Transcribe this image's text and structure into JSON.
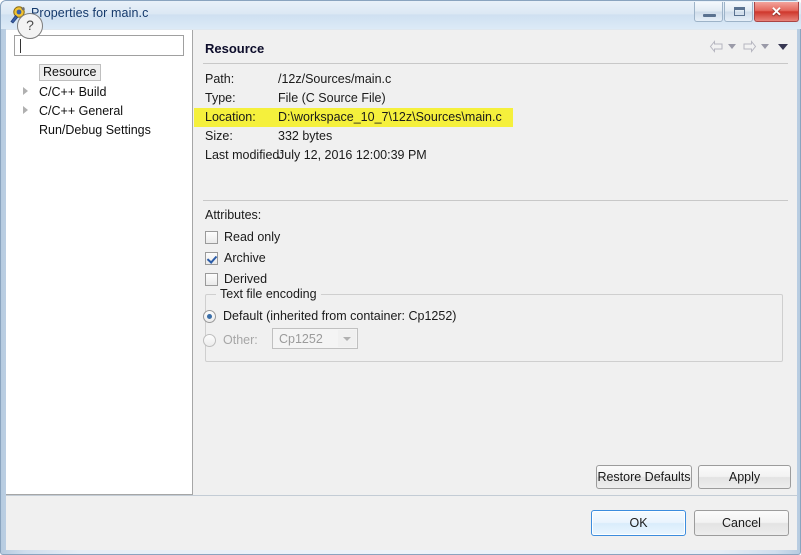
{
  "window": {
    "title": "Properties for main.c",
    "icon": "eclipse-properties-icon",
    "minimize_label": "Minimize",
    "maximize_label": "Maximize",
    "close_label": "Close",
    "close_glyph": "✕"
  },
  "sidebar": {
    "filter": {
      "value": "",
      "placeholder": ""
    },
    "items": [
      {
        "label": "Resource",
        "selected": true,
        "expandable": false
      },
      {
        "label": "C/C++ Build",
        "selected": false,
        "expandable": true
      },
      {
        "label": "C/C++ General",
        "selected": false,
        "expandable": true
      },
      {
        "label": "Run/Debug Settings",
        "selected": false,
        "expandable": false
      }
    ]
  },
  "content": {
    "title": "Resource",
    "nav": {
      "back_label": "Back",
      "forward_label": "Forward",
      "menu_label": "View Menu"
    },
    "properties": [
      {
        "key": "Path:",
        "value": "/12z/Sources/main.c",
        "highlighted": false
      },
      {
        "key": "Type:",
        "value": "File  (C Source File)",
        "highlighted": false
      },
      {
        "key": "Location:",
        "value": "D:\\workspace_10_7\\12z\\Sources\\main.c",
        "highlighted": true
      },
      {
        "key": "Size:",
        "value": "332  bytes",
        "highlighted": false
      },
      {
        "key": "Last modified:",
        "value": "July 12, 2016 12:00:39 PM",
        "highlighted": false
      }
    ],
    "attributes": {
      "label": "Attributes:",
      "items": [
        {
          "label": "Read only",
          "checked": false
        },
        {
          "label": "Archive",
          "checked": true
        },
        {
          "label": "Derived",
          "checked": false
        }
      ]
    },
    "encoding": {
      "group_title": "Text file encoding",
      "default_label": "Default (inherited from container: Cp1252)",
      "default_selected": true,
      "other_label": "Other:",
      "other_selected": false,
      "other_value": "Cp1252",
      "other_disabled": true
    },
    "restore_defaults_label": "Restore Defaults",
    "apply_label": "Apply"
  },
  "footer": {
    "help_label": "?",
    "ok_label": "OK",
    "cancel_label": "Cancel"
  },
  "colors": {
    "highlight": "#f5f03c",
    "titlebar": "#cfe0f1",
    "focus_border": "#3c8dde"
  }
}
